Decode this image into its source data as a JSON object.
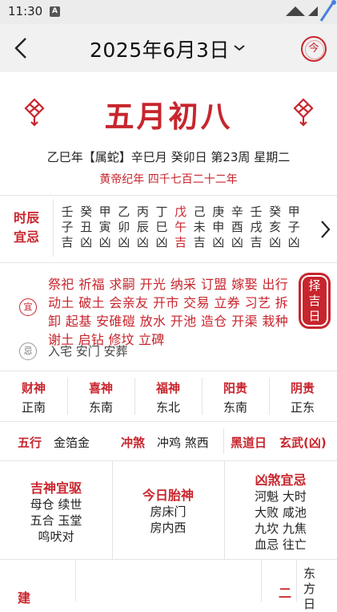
{
  "status": {
    "time": "11:30",
    "notif_letter": "A"
  },
  "header": {
    "title": "2025年6月3日",
    "today_label": "今"
  },
  "lunar": {
    "day": "五月初八",
    "ganzhi": "乙巳年【属蛇】辛巳月 癸卯日 第23周 星期二",
    "huangdi": "黄帝纪年 四千七百二十二年"
  },
  "shichen": {
    "label_line1": "时辰",
    "label_line2": "宜忌",
    "columns": [
      {
        "top": "壬",
        "mid": "子",
        "luck": "吉"
      },
      {
        "top": "癸",
        "mid": "丑",
        "luck": "凶"
      },
      {
        "top": "甲",
        "mid": "寅",
        "luck": "凶"
      },
      {
        "top": "乙",
        "mid": "卯",
        "luck": "凶"
      },
      {
        "top": "丙",
        "mid": "辰",
        "luck": "凶"
      },
      {
        "top": "丁",
        "mid": "巳",
        "luck": "凶"
      },
      {
        "top": "戊",
        "mid": "午",
        "luck": "吉"
      },
      {
        "top": "己",
        "mid": "未",
        "luck": "吉"
      },
      {
        "top": "庚",
        "mid": "申",
        "luck": "凶"
      },
      {
        "top": "辛",
        "mid": "酉",
        "luck": "凶"
      },
      {
        "top": "壬",
        "mid": "戌",
        "luck": "吉"
      },
      {
        "top": "癸",
        "mid": "亥",
        "luck": "凶"
      },
      {
        "top": "甲",
        "mid": "子",
        "luck": "凶"
      }
    ],
    "active_index": 6
  },
  "yiji": {
    "yi_badge": "宜",
    "yi_text": "祭祀 祈福 求嗣 开光 纳采 订盟 嫁娶 出行 动土 破土 会亲友 开市 交易 立券 习艺 拆卸 起基 安碓磑 放水 开池 造仓 开渠 栽种 谢土 启钻 修坟 立碑",
    "ji_badge": "忌",
    "ji_text": "入宅 安门 安葬",
    "zeji_line1": "择",
    "zeji_line2": "吉",
    "zeji_line3": "日"
  },
  "gods": [
    {
      "name": "财神",
      "dir": "正南"
    },
    {
      "name": "喜神",
      "dir": "东南"
    },
    {
      "name": "福神",
      "dir": "东北"
    },
    {
      "name": "阳贵",
      "dir": "东南"
    },
    {
      "name": "阴贵",
      "dir": "正东"
    }
  ],
  "info": {
    "wuxing_label": "五行",
    "wuxing_val": "金箔金",
    "chongsha_label": "冲煞",
    "chongsha_val": "冲鸡 煞西",
    "huangdao_label": "黑道日",
    "huangdao_val": "玄武(凶)"
  },
  "blocks": {
    "jishen_title": "吉神宜驱",
    "jishen_lines": [
      "母仓 续世",
      "五合 玉堂",
      "鸣吠对"
    ],
    "taishen_title": "今日胎神",
    "taishen_lines": [
      "房床门",
      "房内西"
    ],
    "xiongsha_title": "凶煞宜忌",
    "xiongsha_lines": [
      "河魁 大时",
      "大败 咸池",
      "九坎 九焦",
      "血忌 往亡"
    ]
  },
  "last": {
    "left_label": "建",
    "right_char": "二",
    "right_text": [
      "东",
      "方",
      "日"
    ]
  },
  "colors": {
    "accent": "#c8252d",
    "header_bg": "#f1f1f1"
  }
}
